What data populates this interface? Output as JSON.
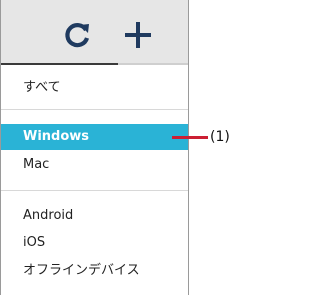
{
  "toolbar": {
    "refresh_icon": "refresh-icon",
    "add_icon": "plus-icon",
    "icon_color": "#1f3a5f"
  },
  "menu": {
    "all_label": "すべて",
    "items": [
      {
        "label": "Windows",
        "selected": true
      },
      {
        "label": "Mac",
        "selected": false
      }
    ],
    "mobile_items": [
      {
        "label": "Android"
      },
      {
        "label": "iOS"
      },
      {
        "label": "オフラインデバイス"
      }
    ],
    "selected_color": "#2ab3d6"
  },
  "callout": {
    "label": "(1)",
    "line_color": "#cc1f33"
  }
}
